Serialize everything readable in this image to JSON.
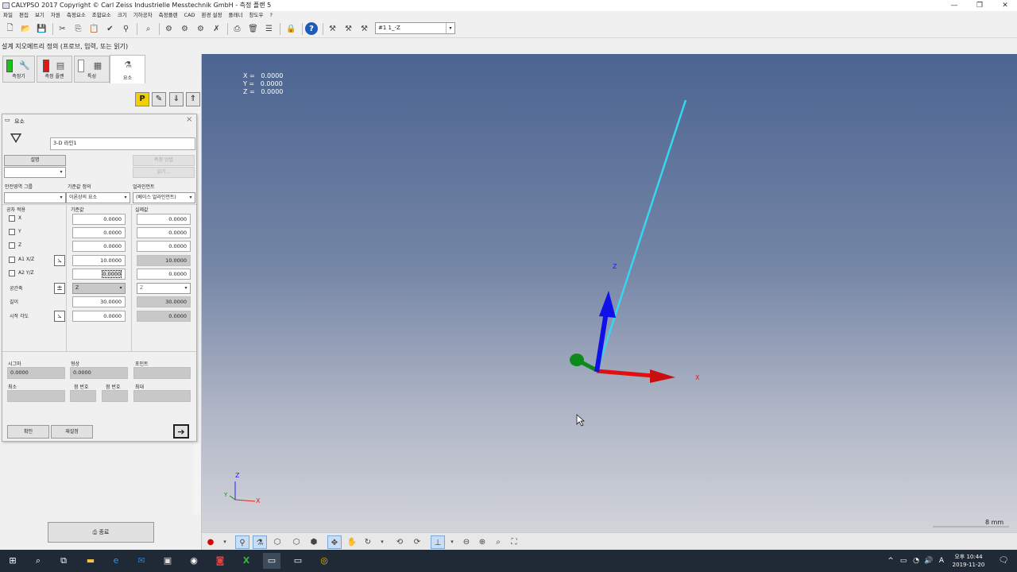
{
  "window": {
    "title": "CALYPSO 2017 Copyright © Carl Zeiss Industrielle Messtechnik GmbH - 측정 플랜 5",
    "controls": [
      "—",
      "❐",
      "✕"
    ]
  },
  "menu": [
    "파일",
    "편집",
    "보기",
    "자원",
    "측정요소",
    "조합요소",
    "크기",
    "기하공차",
    "측정플랜",
    "CAD",
    "환경 설정",
    "플래너",
    "창도우",
    "?"
  ],
  "toolbar": {
    "combo_value": "#1      1_-Z",
    "combo_arrow": "▾"
  },
  "subtitle": "설계 지오메트리 정의 (프로브, 입력, 또는 읽기)",
  "tabs": [
    {
      "label": "측정기"
    },
    {
      "label": "측정 플랜"
    },
    {
      "label": "특성"
    },
    {
      "label": "요소"
    }
  ],
  "panel_buttons": {
    "p": "P",
    "pencil": "✎",
    "down": "⇓",
    "up": "⇑"
  },
  "dialog": {
    "title": "요소",
    "close": "×",
    "name_value": "3-D 라인1",
    "btn_comment": "설명",
    "btn_strategy": "측정 방법",
    "btn_read": "읽기...",
    "label_safety_group": "안전영역 그룹",
    "label_ref_def": "기준값 정의",
    "label_alignment": "얼라인먼트",
    "dd_ref_def": "이론상의 요소",
    "dd_alignment": "(베이스 얼라인먼트)",
    "label_tol": "공차 적용",
    "label_nominal": "기준값",
    "label_actual": "실제값",
    "rows": [
      {
        "label": "X",
        "nominal": "0.0000",
        "actual": "0.0000"
      },
      {
        "label": "Y",
        "nominal": "0.0000",
        "actual": "0.0000"
      },
      {
        "label": "Z",
        "nominal": "0.0000",
        "actual": "0.0000"
      },
      {
        "label": "A1 X/Z",
        "nominal": "10.0000",
        "actual": "10.0000"
      },
      {
        "label": "A2 Y/Z",
        "nominal": "0.0000",
        "actual": "0.0000"
      }
    ],
    "label_space_axis": "공간축",
    "space_axis_nominal": "Z",
    "space_axis_actual": "Z",
    "label_length": "길이",
    "length_nominal": "30.0000",
    "length_actual": "30.0000",
    "label_start_angle": "시작 각도",
    "start_angle_nominal": "0.0000",
    "start_angle_actual": "0.0000",
    "label_sigma": "시그마",
    "sigma_value": "0.0000",
    "label_form": "형상",
    "form_value": "0.0000",
    "label_points": "포인트",
    "label_min": "최소",
    "label_pt_no1": "점 번호",
    "label_pt_no2": "점 번호",
    "label_max": "최대",
    "btn_ok": "확인",
    "btn_reset": "재설정",
    "btn_arrow": "➔"
  },
  "bottom_left_button": "종료",
  "viewport": {
    "coords": [
      {
        "axis": "X =",
        "value": "0.0000"
      },
      {
        "axis": "Y =",
        "value": "0.0000"
      },
      {
        "axis": "Z =",
        "value": "0.0000"
      }
    ],
    "axis_z": "Z",
    "axis_x": "X",
    "mini_axis_z": "Z",
    "mini_axis_y": "Y",
    "mini_axis_x": "X",
    "scale": "8 mm",
    "colors": {
      "line": "#36d6f0",
      "x_axis": "#e01010",
      "y_axis": "#0c8a1a",
      "z_axis": "#1010e8"
    }
  },
  "taskbar": {
    "time": "오후 10:44",
    "date": "2019-11-20",
    "ime": "A"
  }
}
